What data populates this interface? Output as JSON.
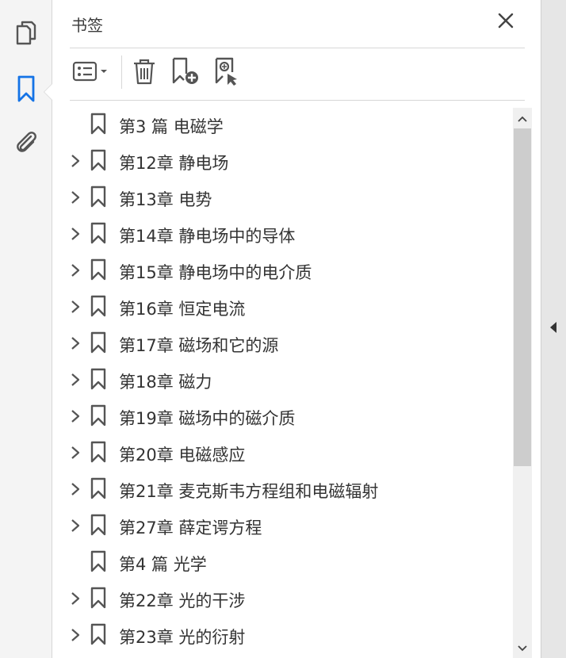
{
  "panel": {
    "title": "书签",
    "accent_color": "#1473e6"
  },
  "rail": {
    "items": [
      {
        "name": "page-thumbnails",
        "icon": "pages-icon"
      },
      {
        "name": "bookmarks",
        "icon": "bookmark-icon",
        "active": true
      },
      {
        "name": "attachments",
        "icon": "paperclip-icon"
      }
    ]
  },
  "toolbar": {
    "items": [
      {
        "icon": "options-menu-icon"
      },
      {
        "icon": "trash-icon"
      },
      {
        "icon": "add-bookmark-icon"
      },
      {
        "icon": "bookmark-search-icon"
      }
    ]
  },
  "bookmarks": [
    {
      "label": "第3 篇 电磁学",
      "expandable": false
    },
    {
      "label": "第12章 静电场",
      "expandable": true
    },
    {
      "label": "第13章 电势",
      "expandable": true
    },
    {
      "label": "第14章 静电场中的导体",
      "expandable": true
    },
    {
      "label": "第15章 静电场中的电介质",
      "expandable": true
    },
    {
      "label": "第16章 恒定电流",
      "expandable": true
    },
    {
      "label": "第17章 磁场和它的源",
      "expandable": true
    },
    {
      "label": "第18章 磁力",
      "expandable": true
    },
    {
      "label": "第19章 磁场中的磁介质",
      "expandable": true
    },
    {
      "label": "第20章 电磁感应",
      "expandable": true
    },
    {
      "label": "第21章 麦克斯韦方程组和电磁辐射",
      "expandable": true
    },
    {
      "label": "第27章 薛定谔方程",
      "expandable": true
    },
    {
      "label": "第4 篇 光学",
      "expandable": false
    },
    {
      "label": "第22章 光的干涉",
      "expandable": true
    },
    {
      "label": "第23章 光的衍射",
      "expandable": true
    }
  ]
}
